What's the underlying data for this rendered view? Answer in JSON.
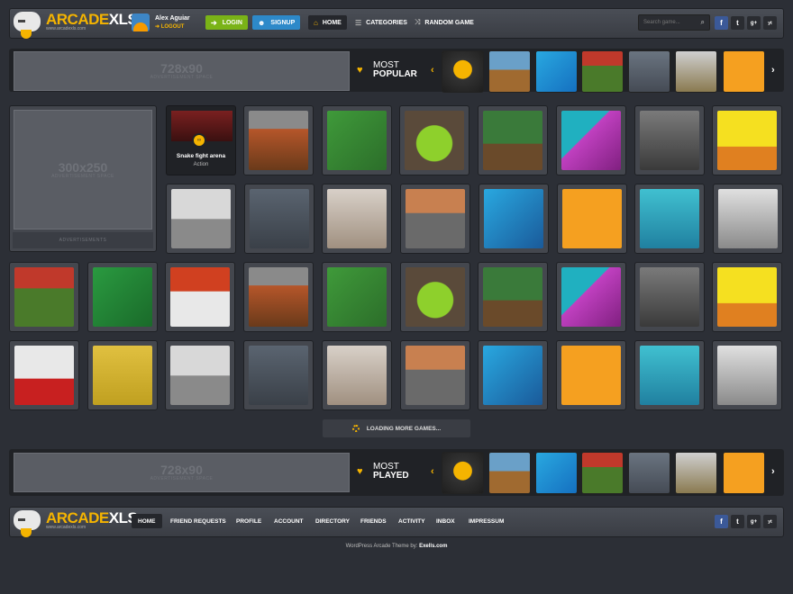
{
  "header": {
    "logo": {
      "part1": "ARCADE",
      "part2": "XLS",
      "url": "www.arcadexls.com"
    },
    "user": {
      "name": "Alex Aguiar",
      "logout": "LOGOUT"
    },
    "login_label": "LOGIN",
    "signup_label": "SIGNUP",
    "nav": [
      {
        "label": "HOME",
        "icon": "home-icon"
      },
      {
        "label": "CATEGORIES",
        "icon": "list-icon"
      },
      {
        "label": "RANDOM GAME",
        "icon": "shuffle-icon"
      }
    ],
    "search": {
      "placeholder": "Search game..."
    },
    "social": [
      "f",
      "t",
      "g+",
      "yt"
    ]
  },
  "top_ad": {
    "size": "728x90",
    "text": "ADVERTISEMENT SPACE"
  },
  "most_popular": {
    "line1": "MOST",
    "line2": "POPULAR"
  },
  "side_ad": {
    "size": "300x250",
    "text": "ADVERTISEMENT SPACE",
    "footer": "ADVERTISEMENTS"
  },
  "featured_game": {
    "title": "Snake fight arena",
    "category": "Action"
  },
  "loading": "LOADING MORE GAMES...",
  "bottom_ad": {
    "size": "728x90",
    "text": "ADVERTISEMENT SPACE"
  },
  "most_played": {
    "line1": "MOST",
    "line2": "PLAYED"
  },
  "footer": {
    "logo": {
      "part1": "ARCADE",
      "part2": "XLS",
      "url": "www.arcadexls.com"
    },
    "nav": [
      "HOME",
      "FRIEND REQUESTS",
      "PROFILE",
      "ACCOUNT",
      "DIRECTORY",
      "FRIENDS",
      "ACTIVITY",
      "INBOX",
      "IMPRESSUM"
    ],
    "credit_prefix": "WordPress Arcade Theme by:",
    "credit_name": "Exells.com"
  },
  "colors": {
    "accent": "#f5b400",
    "login": "#7ab317",
    "signup": "#2d89c9",
    "facebook": "#3b5998"
  }
}
